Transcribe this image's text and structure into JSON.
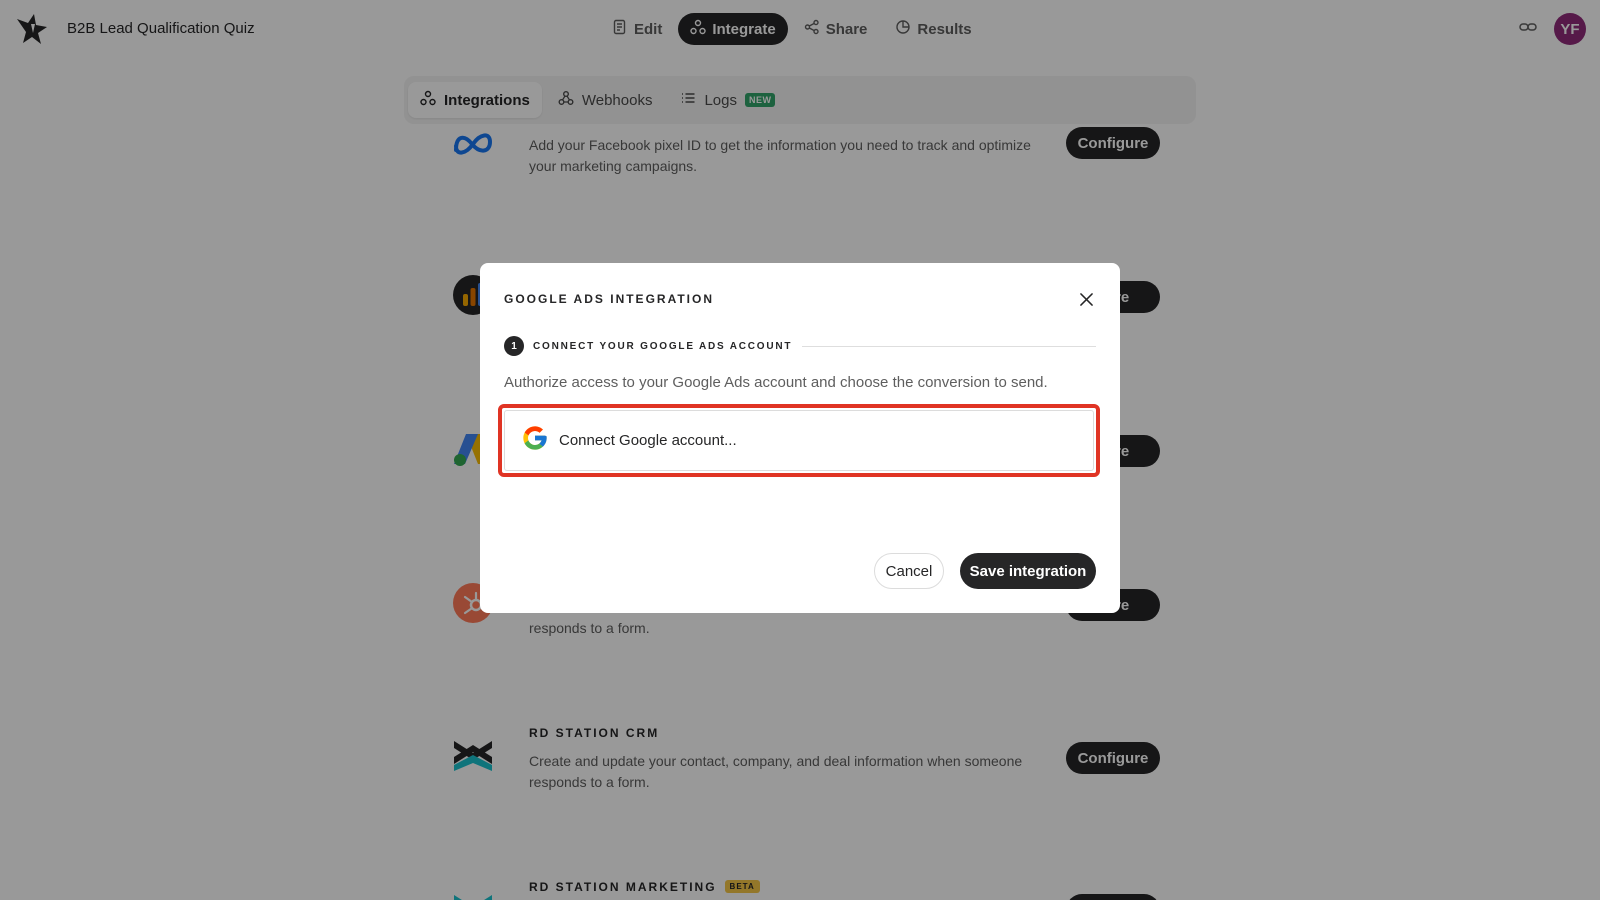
{
  "app": {
    "title": "B2B Lead Qualification Quiz",
    "avatar_initials": "YF"
  },
  "nav": {
    "items": [
      {
        "label": "Edit",
        "icon": "edit-icon",
        "active": false
      },
      {
        "label": "Integrate",
        "icon": "integrate-icon",
        "active": true
      },
      {
        "label": "Share",
        "icon": "share-icon",
        "active": false
      },
      {
        "label": "Results",
        "icon": "results-icon",
        "active": false
      }
    ]
  },
  "subnav": {
    "tabs": [
      {
        "label": "Integrations",
        "icon": "integrations-icon",
        "active": true
      },
      {
        "label": "Webhooks",
        "icon": "webhooks-icon",
        "active": false
      },
      {
        "label": "Logs",
        "icon": "logs-icon",
        "active": false,
        "badge": "NEW"
      }
    ]
  },
  "integrations": [
    {
      "name": "",
      "logo": "meta-icon",
      "description": "Add your Facebook pixel ID to get the information you need to track and optimize your marketing campaigns.",
      "button": "Configure"
    },
    {
      "name": "",
      "logo": "google-analytics-icon",
      "description": "",
      "button": "gure"
    },
    {
      "name": "",
      "logo": "google-ads-icon",
      "description": "",
      "button": "gure"
    },
    {
      "name": "",
      "logo": "hubspot-icon",
      "description": "responds to a form.",
      "button": "gure"
    },
    {
      "name": "RD STATION CRM",
      "logo": "rd-station-icon",
      "description": "Create and update your contact, company, and deal information when someone responds to a form.",
      "button": "Configure"
    },
    {
      "name": "RD STATION MARKETING",
      "logo": "rd-station-icon",
      "badge": "BETA",
      "description": "",
      "button": ""
    }
  ],
  "modal": {
    "title": "GOOGLE ADS INTEGRATION",
    "step_number": "1",
    "step_label": "CONNECT YOUR GOOGLE ADS ACCOUNT",
    "description": "Authorize access to your Google Ads account and choose the conversion to send.",
    "connect_label": "Connect Google account...",
    "cancel_label": "Cancel",
    "save_label": "Save integration"
  },
  "colors": {
    "dark": "#262627",
    "highlight": "#e03424",
    "avatar": "#8f2a7a"
  }
}
